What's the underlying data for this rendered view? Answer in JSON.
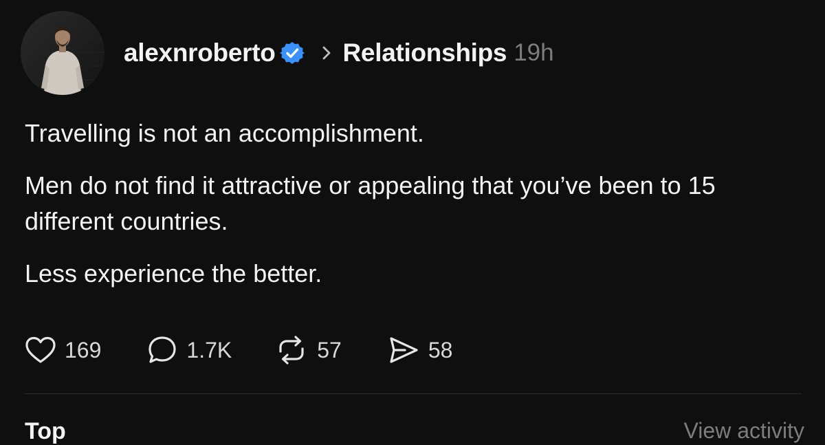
{
  "post": {
    "username": "alexnroberto",
    "topic": "Relationships",
    "timestamp": "19h",
    "paragraphs": [
      "Travelling is not an accomplishment.",
      "Men do not find it attractive or appealing that you’ve been to 15 different countries.",
      "Less experience the better."
    ],
    "stats": {
      "likes": "169",
      "replies": "1.7K",
      "reposts": "57",
      "shares": "58"
    }
  },
  "footer": {
    "left_label": "Top",
    "right_label": "View activity"
  },
  "colors": {
    "background": "#0f0f0f",
    "text": "#f3f3f3",
    "muted": "#7d7d7d",
    "verified_blue": "#3b91f7",
    "divider": "#2c2c2c"
  },
  "icons": {
    "verified": "verified-badge-icon",
    "chevron": "chevron-right-icon",
    "like": "heart-icon",
    "reply": "comment-bubble-icon",
    "repost": "repost-icon",
    "share": "send-icon"
  }
}
